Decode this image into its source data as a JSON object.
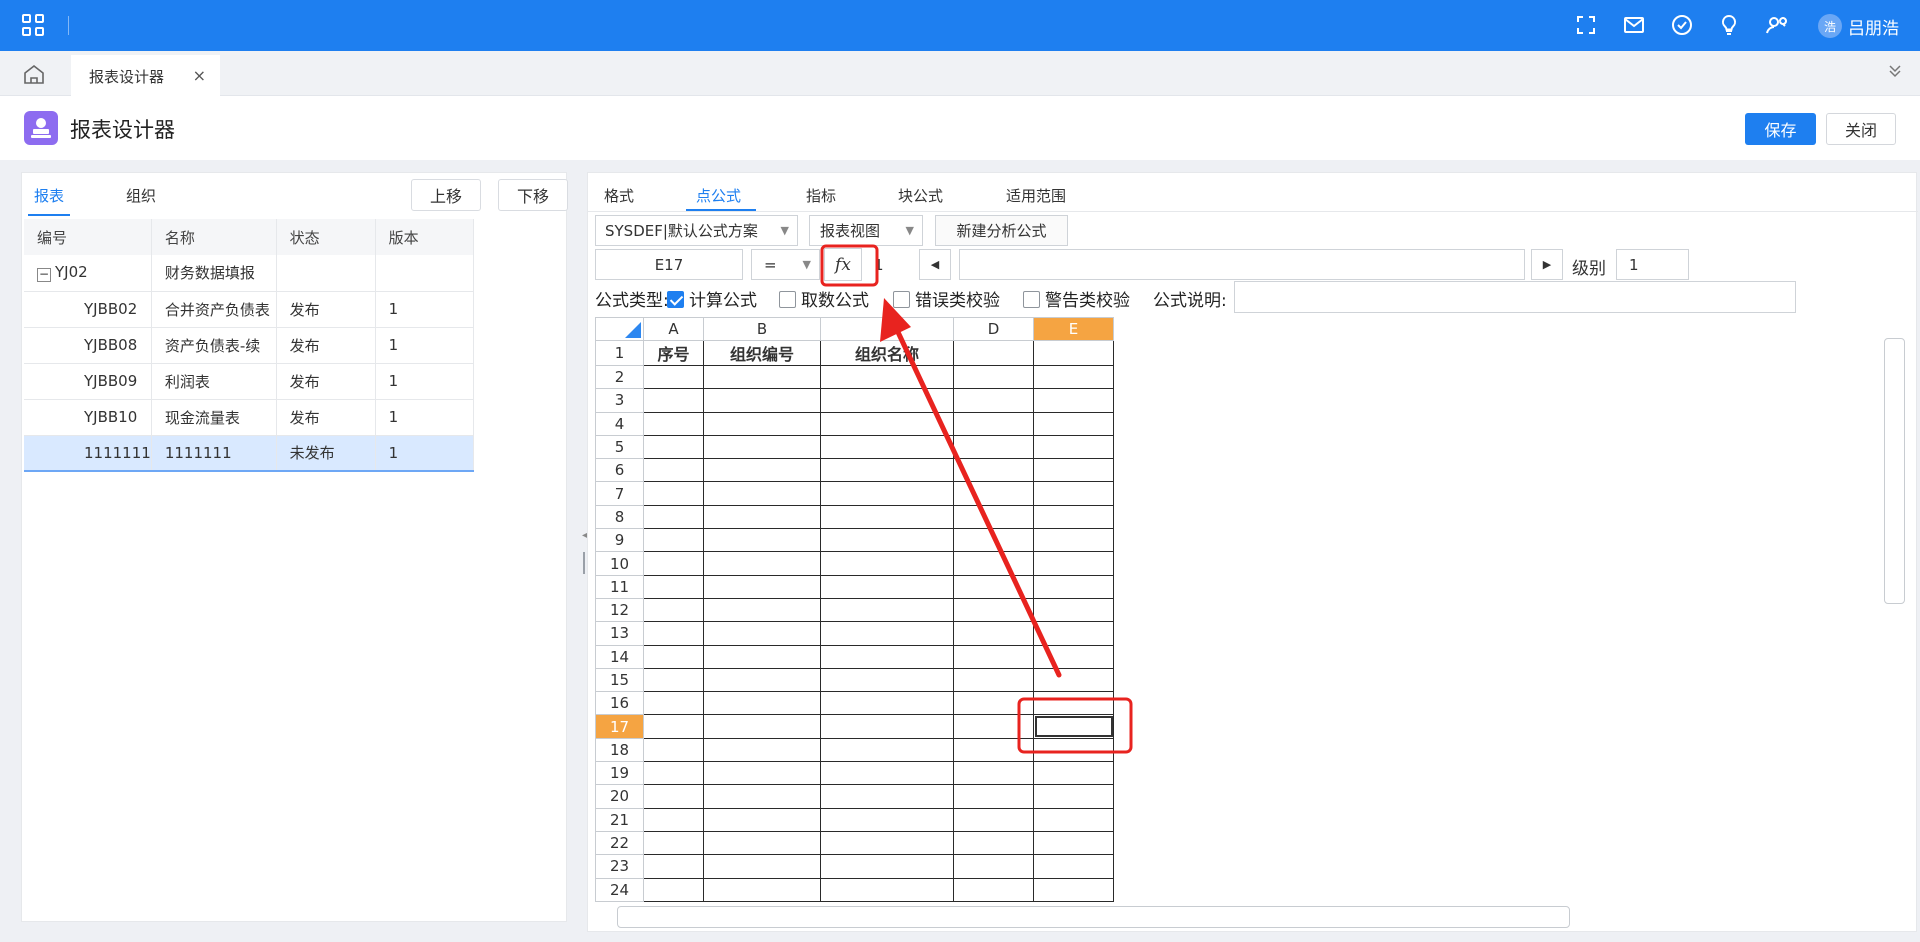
{
  "topbar": {
    "icons": [
      "apps-grid-icon",
      "fullscreen-icon",
      "mail-icon",
      "check-circle-icon",
      "bulb-icon",
      "user-search-icon"
    ],
    "avatar_text": "浩",
    "user_name": "吕朋浩"
  },
  "tabs": [
    {
      "label": "报表设计器",
      "close": "×"
    }
  ],
  "page": {
    "title": "报表设计器",
    "save": "保存",
    "close": "关闭"
  },
  "left": {
    "tabs": [
      "报表",
      "组织"
    ],
    "move_up": "上移",
    "move_down": "下移",
    "columns": [
      "编号",
      "名称",
      "状态",
      "版本"
    ],
    "rows": [
      {
        "code": "YJ02",
        "name": "财务数据填报",
        "status": "",
        "version": "",
        "group": true,
        "expander": "−"
      },
      {
        "code": "YJBB02",
        "name": "合并资产负债表",
        "status": "发布",
        "version": "1"
      },
      {
        "code": "YJBB08",
        "name": "资产负债表-续",
        "status": "发布",
        "version": "1"
      },
      {
        "code": "YJBB09",
        "name": "利润表",
        "status": "发布",
        "version": "1"
      },
      {
        "code": "YJBB10",
        "name": "现金流量表",
        "status": "发布",
        "version": "1"
      },
      {
        "code": "1111111",
        "name": "1111111",
        "status": "未发布",
        "version": "1",
        "selected": true
      }
    ]
  },
  "right": {
    "tabs": [
      "格式",
      "点公式",
      "指标",
      "块公式",
      "适用范围"
    ],
    "active_tab": "点公式",
    "scheme_select": "SYSDEF|默认公式方案",
    "view_select": "报表视图",
    "new_analysis": "新建分析公式",
    "cell_ref": "E17",
    "operator": "=",
    "fx": "fx",
    "level_small": "1",
    "formula_value": "",
    "level_label": "级别",
    "level_value": "1",
    "formula_type_label": "公式类型:",
    "checkboxes": [
      {
        "label": "计算公式",
        "checked": true
      },
      {
        "label": "取数公式",
        "checked": false
      },
      {
        "label": "错误类校验",
        "checked": false
      },
      {
        "label": "警告类校验",
        "checked": false
      }
    ],
    "formula_desc_label": "公式说明:",
    "formula_desc_value": ""
  },
  "sheet": {
    "columns": [
      "A",
      "B",
      "C",
      "D",
      "E"
    ],
    "active_column": "E",
    "active_row": 17,
    "header_row": [
      "序号",
      "组织编号",
      "组织名称",
      "",
      ""
    ],
    "row_numbers": [
      "1",
      "2",
      "3",
      "4",
      "5",
      "6",
      "7",
      "8",
      "9",
      "10",
      "11",
      "12",
      "13",
      "14",
      "15",
      "16",
      "17",
      "18",
      "19",
      "20",
      "21",
      "22",
      "23",
      "24"
    ]
  },
  "colors": {
    "accent": "#1e7ff0",
    "active_header": "#f5a442",
    "annotation": "#e8231f",
    "selected_row": "#d9e9ff"
  }
}
